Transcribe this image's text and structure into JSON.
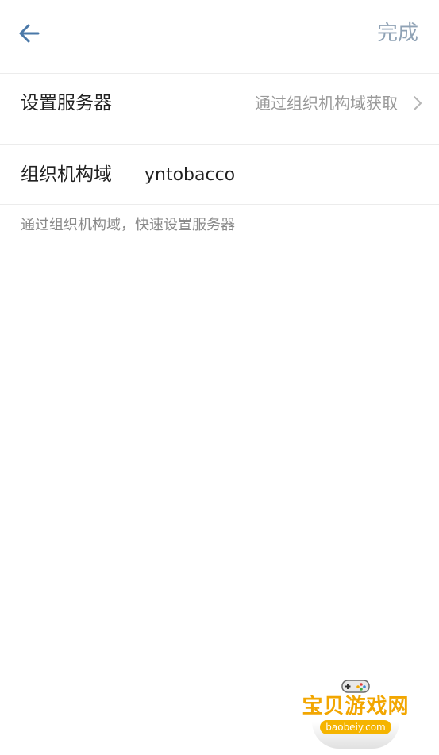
{
  "header": {
    "back_icon": "arrow-left-icon",
    "done_label": "完成",
    "accent_color": "#4a78a8"
  },
  "server_row": {
    "label": "设置服务器",
    "value": "通过组织机构域获取",
    "chevron_icon": "chevron-right-icon"
  },
  "domain_row": {
    "label": "组织机构域",
    "input_value": "yntobacco"
  },
  "hint": {
    "text": "通过组织机构域，快速设置服务器"
  },
  "watermark": {
    "title": "宝贝游戏网",
    "site": "baobeiy.com",
    "icon": "gamepad-icon"
  }
}
